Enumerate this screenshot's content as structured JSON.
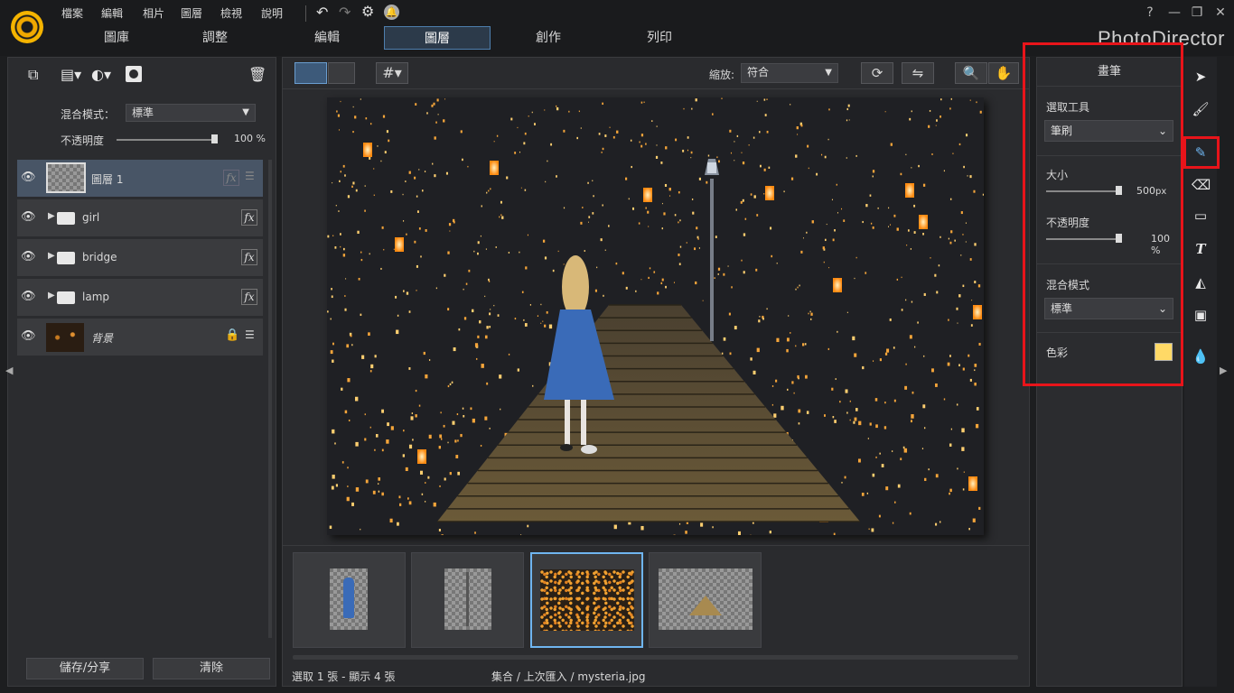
{
  "menu": [
    "檔案",
    "編輯",
    "相片",
    "圖層",
    "檢視",
    "說明"
  ],
  "tabs": [
    "圖庫",
    "調整",
    "編輯",
    "圖層",
    "創作",
    "列印"
  ],
  "active_tab": "圖層",
  "brand": "PhotoDirector",
  "window_buttons": {
    "help": "?",
    "minimize": "—",
    "restore": "❐",
    "close": "✕"
  },
  "layers_panel": {
    "blend_label": "混合模式：",
    "blend_value": "標準",
    "opacity_label": "不透明度",
    "opacity_value": "100 %",
    "opacity_fraction": 1.0,
    "layers": [
      {
        "name": "圖層 1",
        "type": "layer",
        "selected": true
      },
      {
        "name": "girl",
        "type": "folder"
      },
      {
        "name": "bridge",
        "type": "folder"
      },
      {
        "name": "lamp",
        "type": "folder"
      },
      {
        "name": "背景",
        "type": "background",
        "locked": true
      }
    ],
    "fx_label": "fx",
    "save_share": "儲存/分享",
    "clear": "清除"
  },
  "center": {
    "zoom_label": "縮放:",
    "zoom_value": "符合",
    "status_left": "選取 1 張 - 顯示 4 張",
    "status_right": "集合 / 上次匯入 / mysteria.jpg",
    "thumbnails": [
      "girl",
      "lamp",
      "mysteria",
      "bridge"
    ],
    "selected_thumbnail": "mysteria"
  },
  "brush_panel": {
    "title": "畫筆",
    "tool_label": "選取工具",
    "tool_value": "筆刷",
    "size_label": "大小",
    "size_value": "500",
    "size_unit": "px",
    "size_fraction": 1.0,
    "opacity_label": "不透明度",
    "opacity_value": "100 %",
    "opacity_fraction": 1.0,
    "blend_label": "混合模式",
    "blend_value": "標準",
    "color_label": "色彩",
    "color_value": "#ffd966"
  },
  "colors": {
    "highlight": "#e8141a",
    "accent": "#4e7fae"
  }
}
